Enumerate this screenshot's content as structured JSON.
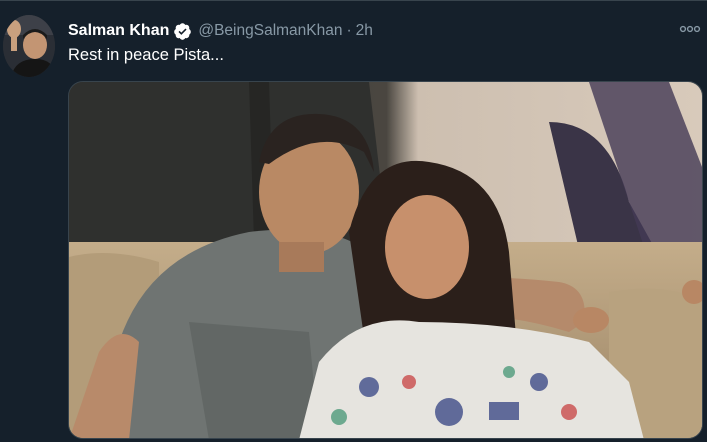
{
  "tweet": {
    "author_name": "Salman Khan",
    "author_handle": "@BeingSalmanKhan",
    "separator": "·",
    "timestamp": "2h",
    "text": "Rest in peace Pista...",
    "verified": true
  },
  "icons": {
    "verified": "verified-badge-icon",
    "more": "more-options-icon"
  },
  "colors": {
    "background": "#15202b",
    "primary_text": "#ffffff",
    "secondary_text": "#8899a6",
    "verified_badge": "#ffffff"
  }
}
